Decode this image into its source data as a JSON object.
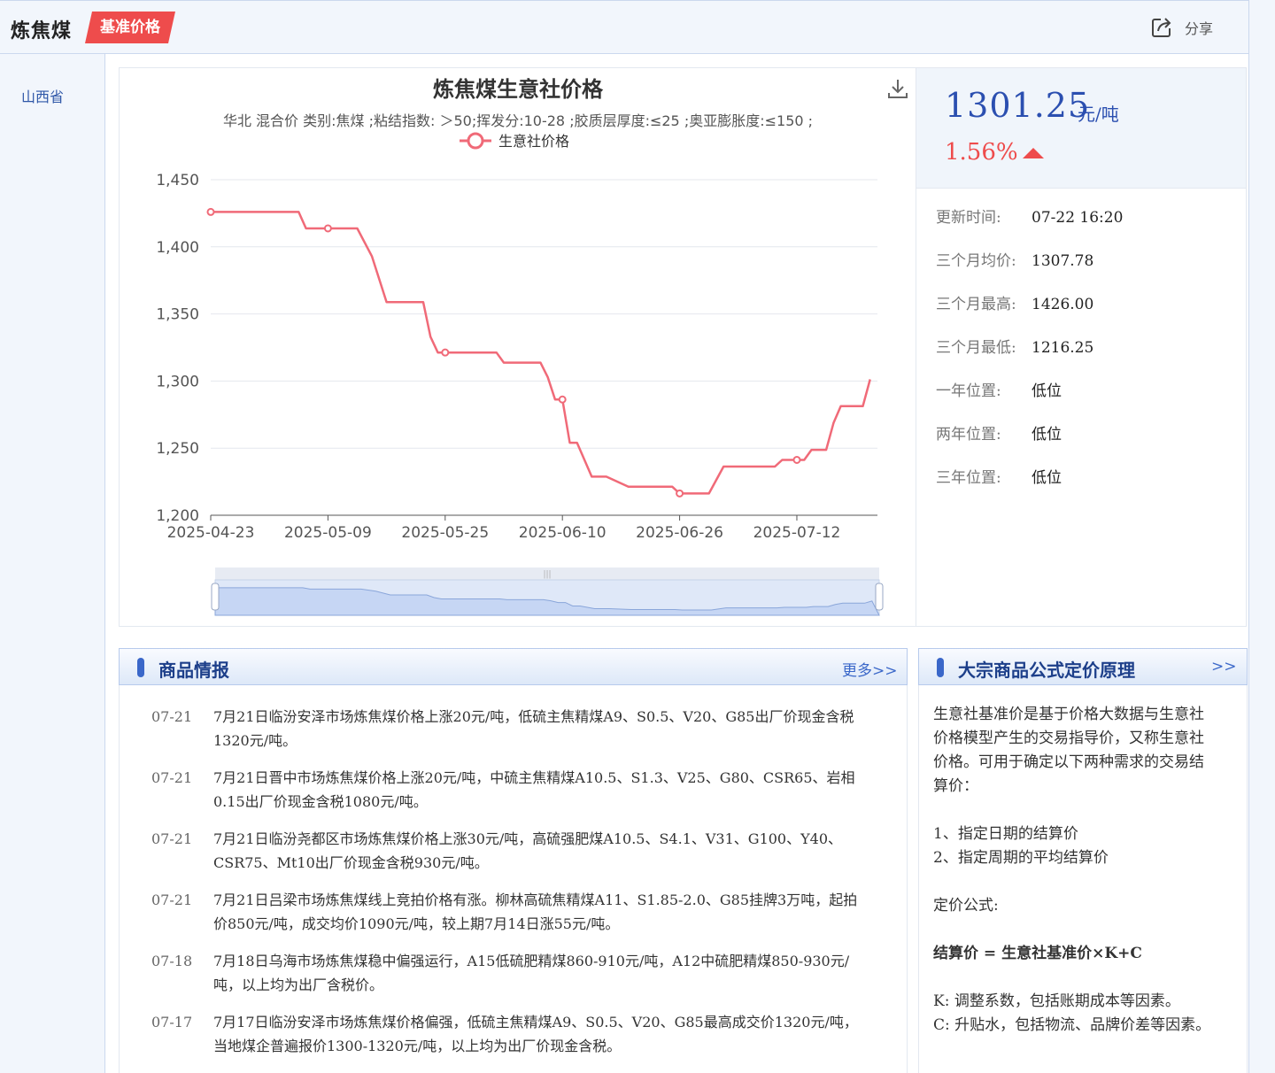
{
  "header": {
    "title": "炼焦煤",
    "badge": "基准价格",
    "share_label": "分享"
  },
  "sidebar": {
    "province": "山西省"
  },
  "chart_card": {
    "title": "炼焦煤生意社价格",
    "subtitle": "华北 混合价 类别:焦煤 ;粘结指数: ＞50;挥发分:10-28 ;胶质层厚度:≤25 ;奥亚膨胀度:≤150 ;"
  },
  "chart_data": {
    "type": "line",
    "title": "炼焦煤生意社价格",
    "legend": [
      "生意社价格"
    ],
    "legend_position": "top",
    "x_start": "2025-04-23",
    "x_ticks": [
      "2025-04-23",
      "2025-05-09",
      "2025-05-25",
      "2025-06-10",
      "2025-06-26",
      "2025-07-12"
    ],
    "ylim": [
      1200,
      1450
    ],
    "y_ticks": [
      "1,200",
      "1,250",
      "1,300",
      "1,350",
      "1,400",
      "1,450"
    ],
    "grid": true,
    "color": "#f06a78",
    "series": [
      {
        "name": "生意社价格",
        "x": [
          "2025-04-23",
          "2025-05-05",
          "2025-05-06",
          "2025-05-09",
          "2025-05-13",
          "2025-05-15",
          "2025-05-17",
          "2025-05-22",
          "2025-05-23",
          "2025-05-24",
          "2025-05-25",
          "2025-06-01",
          "2025-06-02",
          "2025-06-07",
          "2025-06-08",
          "2025-06-09",
          "2025-06-10",
          "2025-06-11",
          "2025-06-12",
          "2025-06-14",
          "2025-06-15",
          "2025-06-16",
          "2025-06-19",
          "2025-06-20",
          "2025-06-25",
          "2025-06-26",
          "2025-06-30",
          "2025-07-02",
          "2025-07-09",
          "2025-07-10",
          "2025-07-12",
          "2025-07-13",
          "2025-07-14",
          "2025-07-16",
          "2025-07-17",
          "2025-07-18",
          "2025-07-21",
          "2025-07-22"
        ],
        "values": [
          1426,
          1426,
          1413.75,
          1413.75,
          1413.75,
          1393,
          1358.75,
          1358.75,
          1333,
          1321.25,
          1321.25,
          1321.25,
          1313.75,
          1313.75,
          1303,
          1286.25,
          1286.25,
          1254,
          1254,
          1228.75,
          1228.75,
          1228.75,
          1221.25,
          1221.25,
          1221.25,
          1216.25,
          1216.25,
          1236.25,
          1236.25,
          1241.25,
          1241.25,
          1241.25,
          1248.75,
          1248.75,
          1268.75,
          1281.25,
          1281.25,
          1301.25
        ],
        "markers": [
          "2025-04-23",
          "2025-05-09",
          "2025-05-25",
          "2025-06-10",
          "2025-06-26",
          "2025-07-12"
        ]
      }
    ],
    "datazoom": true
  },
  "price_card": {
    "price": "1301.25",
    "unit": "元/吨",
    "change": "1.56%",
    "trend_icon": "arrow-up-icon",
    "stats": [
      {
        "key": "更新时间:",
        "value": "07-22 16:20"
      },
      {
        "key": "三个月均价:",
        "value": "1307.78"
      },
      {
        "key": "三个月最高:",
        "value": "1426.00"
      },
      {
        "key": "三个月最低:",
        "value": "1216.25"
      },
      {
        "key": "一年位置:",
        "value": "低位"
      },
      {
        "key": "两年位置:",
        "value": "低位"
      },
      {
        "key": "三年位置:",
        "value": "低位"
      }
    ]
  },
  "news": {
    "title": "商品情报",
    "more": "更多>>",
    "items": [
      {
        "date": "07-21",
        "text": "7月21日临汾安泽市场炼焦煤价格上涨20元/吨，低硫主焦精煤A9、S0.5、V20、G85出厂价现金含税1320元/吨。"
      },
      {
        "date": "07-21",
        "text": "7月21日晋中市场炼焦煤价格上涨20元/吨，中硫主焦精煤A10.5、S1.3、V25、G80、CSR65、岩相0.15出厂价现金含税1080元/吨。"
      },
      {
        "date": "07-21",
        "text": "7月21日临汾尧都区市场炼焦煤价格上涨30元/吨，高硫强肥煤A10.5、S4.1、V31、G100、Y40、CSR75、Mt10出厂价现金含税930元/吨。"
      },
      {
        "date": "07-21",
        "text": "7月21日吕梁市场炼焦煤线上竞拍价格有涨。柳林高硫焦精煤A11、S1.85-2.0、G85挂牌3万吨，起拍价850元/吨，成交均价1090元/吨，较上期7月14日涨55元/吨。"
      },
      {
        "date": "07-18",
        "text": "7月18日乌海市场炼焦煤稳中偏强运行，A15低硫肥精煤860-910元/吨，A12中硫肥精煤850-930元/吨，以上均为出厂含税价。"
      },
      {
        "date": "07-17",
        "text": "7月17日临汾安泽市场炼焦煤价格偏强，低硫主焦精煤A9、S0.5、V20、G85最高成交价1320元/吨，当地煤企普遍报价1300-1320元/吨，以上均为出厂价现金含税。"
      }
    ]
  },
  "formula": {
    "title": "大宗商品公式定价原理",
    "more": ">>",
    "lines": [
      "生意社基准价是基于价格大数据与生意社",
      "价格模型产生的交易指导价，又称生意社",
      "价格。可用于确定以下两种需求的交易结",
      "算价：",
      "",
      "1、指定日期的结算价",
      "2、指定周期的平均结算价",
      "",
      "定价公式:",
      "",
      "结算价 = 生意社基准价×K+C",
      "",
      "K: 调整系数，包括账期成本等因素。",
      "C: 升贴水，包括物流、品牌价差等因素。"
    ]
  }
}
